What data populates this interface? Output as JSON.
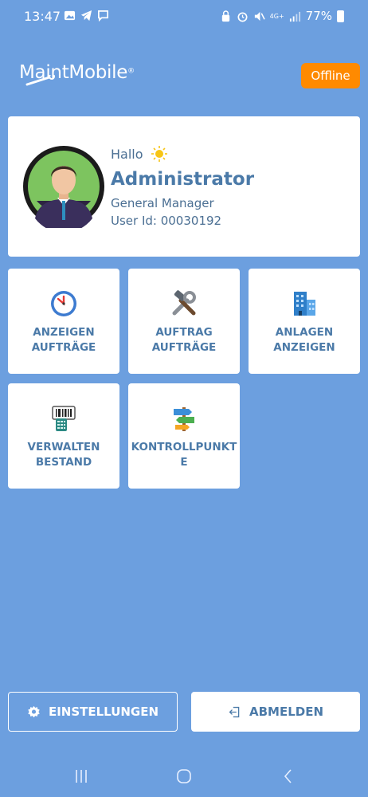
{
  "status_bar": {
    "time": "13:47",
    "network": "4G+",
    "battery": "77%"
  },
  "header": {
    "logo_text": "MaintMobile",
    "logo_mark": "®",
    "offline_label": "Offline"
  },
  "profile": {
    "greeting": "Hallo",
    "name": "Administrator",
    "role": "General Manager",
    "user_id": "User Id: 00030192"
  },
  "tiles": [
    {
      "label": "ANZEIGEN\nAUFTRÄGE",
      "icon": "clock-icon"
    },
    {
      "label": "AUFTRAG\nAUFTRÄGE",
      "icon": "tools-icon"
    },
    {
      "label": "ANLAGEN\nANZEIGEN",
      "icon": "building-icon"
    },
    {
      "label": "VERWALTEN\nBESTAND",
      "icon": "barcode-scanner-icon"
    },
    {
      "label": "KONTROLLPUNKT\nE",
      "icon": "signpost-icon"
    }
  ],
  "buttons": {
    "settings": "EINSTELLUNGEN",
    "logout": "ABMELDEN"
  },
  "colors": {
    "background": "#6c9fdf",
    "accent_text": "#4b7aa8",
    "offline_badge": "#ff8a00"
  }
}
